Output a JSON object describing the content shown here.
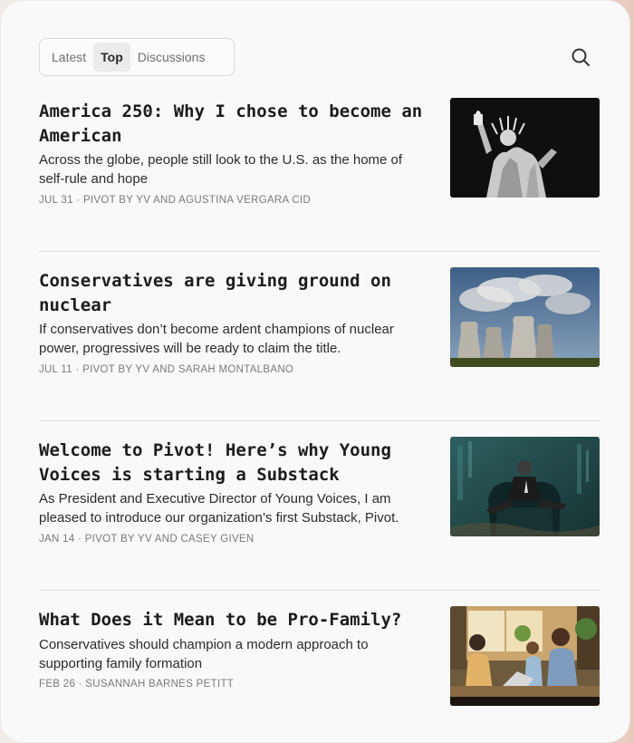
{
  "tabs": [
    {
      "label": "Latest",
      "active": false
    },
    {
      "label": "Top",
      "active": true
    },
    {
      "label": "Discussions",
      "active": false
    }
  ],
  "posts": [
    {
      "title": "America 250: Why I chose to become an American",
      "subtitle": "Across the globe, people still look to the U.S. as the home of self-rule and hope",
      "date": "JUL 31",
      "separator": "·",
      "byline": "PIVOT BY YV AND AGUSTINA VERGARA CID",
      "image_icon": "statue-of-liberty-image"
    },
    {
      "title": "Conservatives are giving ground on nuclear",
      "subtitle": "If conservatives don’t become ardent champions of nuclear power, progressives will be ready to claim the title.",
      "date": "JUL 11",
      "separator": "·",
      "byline": "PIVOT BY YV AND SARAH MONTALBANO",
      "image_icon": "cooling-towers-image"
    },
    {
      "title": "Welcome to Pivot! Here’s why Young Voices is starting a Substack",
      "subtitle": "As President and Executive Director of Young Voices, I am pleased to introduce our organization’s first Substack, Pivot.",
      "date": "JAN 14",
      "separator": "·",
      "byline": "PIVOT BY YV AND CASEY GIVEN",
      "image_icon": "man-in-armchair-image"
    },
    {
      "title": "What Does it Mean to be Pro-Family?",
      "subtitle": "Conservatives should champion a modern approach to supporting family formation",
      "date": "FEB 26",
      "separator": "·",
      "byline": "SUSANNAH BARNES PETITT",
      "image_icon": "family-at-table-image"
    }
  ],
  "search_icon": "search-icon",
  "colors": {
    "card_bg": "#f9f9f9",
    "title": "#1c1c1c",
    "meta": "#7a7a7a",
    "divider": "#dcdcdc",
    "active_tab_bg": "#ebebeb"
  }
}
